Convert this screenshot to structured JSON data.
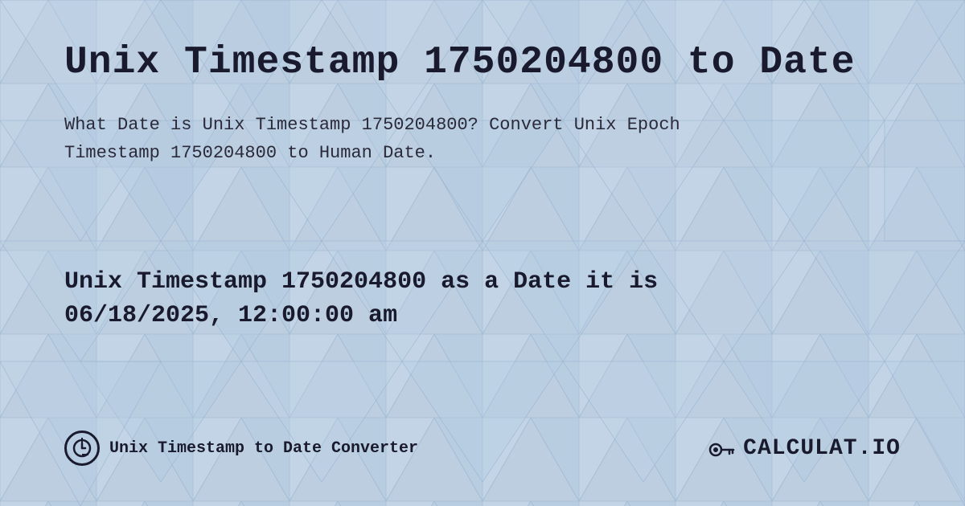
{
  "page": {
    "title": "Unix Timestamp 1750204800 to Date",
    "description_line1": "What Date is Unix Timestamp 1750204800? Convert Unix Epoch",
    "description_line2": "Timestamp 1750204800 to Human Date.",
    "result_line1": "Unix Timestamp 1750204800 as a Date it is",
    "result_line2": "06/18/2025, 12:00:00 am",
    "footer_label": "Unix Timestamp to Date Converter",
    "logo_text": "CALCULAT.IO",
    "bg_color": "#c8d8e8"
  }
}
